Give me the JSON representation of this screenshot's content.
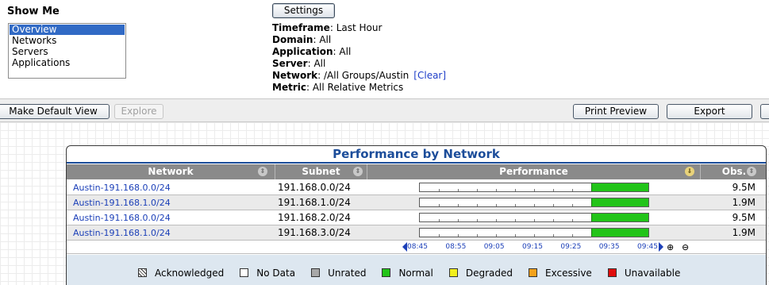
{
  "show_me": {
    "title": "Show Me",
    "options": [
      "Overview",
      "Networks",
      "Servers",
      "Applications"
    ],
    "selected": "Overview"
  },
  "settings": {
    "button_label": "Settings",
    "filters": [
      {
        "key": "Timeframe",
        "value": "Last Hour"
      },
      {
        "key": "Domain",
        "value": "All"
      },
      {
        "key": "Application",
        "value": "All"
      },
      {
        "key": "Server",
        "value": "All"
      },
      {
        "key": "Network",
        "value": "/All Groups/Austin"
      },
      {
        "key": "Metric",
        "value": "All Relative Metrics"
      }
    ],
    "clear_label": "[Clear]"
  },
  "toolbar": {
    "make_default_label": "Make Default View",
    "explore_label": "Explore",
    "print_preview_label": "Print Preview",
    "export_label": "Export"
  },
  "panel": {
    "title": "Performance by Network",
    "columns": {
      "network": "Network",
      "subnet": "Subnet",
      "performance": "Performance",
      "obs": "Obs."
    },
    "rows": [
      {
        "network": "Austin-191.168.0.0/24",
        "subnet": "191.168.0.0/24",
        "obs": "9.5M",
        "normal_fraction": 0.25
      },
      {
        "network": "Austin-191.168.1.0/24",
        "subnet": "191.168.1.0/24",
        "obs": "1.9M",
        "normal_fraction": 0.25
      },
      {
        "network": "Austin-191.168.0.0/24",
        "subnet": "191.168.2.0/24",
        "obs": "9.5M",
        "normal_fraction": 0.25
      },
      {
        "network": "Austin-191.168.1.0/24",
        "subnet": "191.168.3.0/24",
        "obs": "1.9M",
        "normal_fraction": 0.25
      }
    ],
    "time_labels": [
      "08:45",
      "08:55",
      "09:05",
      "09:15",
      "09:25",
      "09:35",
      "09:45"
    ]
  },
  "legend": [
    {
      "label": "Acknowledged",
      "color": "hatch"
    },
    {
      "label": "No Data",
      "color": "#ffffff"
    },
    {
      "label": "Unrated",
      "color": "#a8a8a8"
    },
    {
      "label": "Normal",
      "color": "#22c419"
    },
    {
      "label": "Degraded",
      "color": "#f2ef1e"
    },
    {
      "label": "Excessive",
      "color": "#f4a21c"
    },
    {
      "label": "Unavailable",
      "color": "#e00d0d"
    }
  ]
}
